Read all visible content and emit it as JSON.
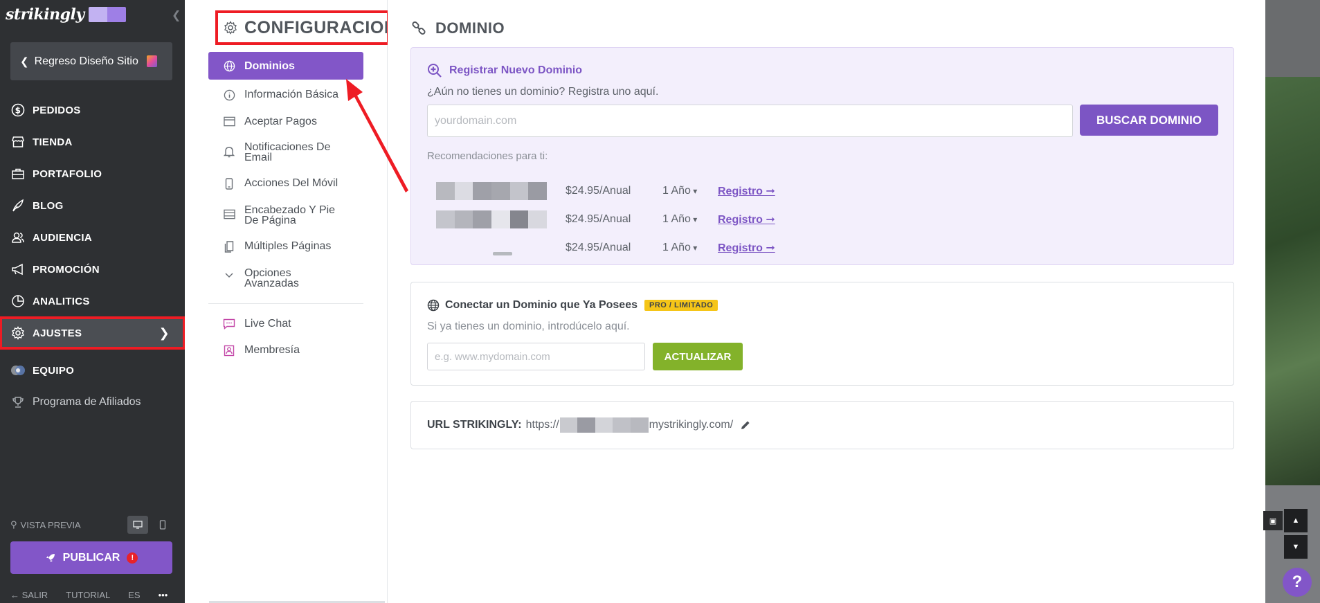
{
  "sidebar": {
    "logo_text": "strikingly",
    "back_label": "Regreso Diseño Sitio",
    "items": [
      {
        "label": "PEDIDOS",
        "icon": "dollar-icon"
      },
      {
        "label": "TIENDA",
        "icon": "store-icon"
      },
      {
        "label": "PORTAFOLIO",
        "icon": "briefcase-icon"
      },
      {
        "label": "BLOG",
        "icon": "feather-icon"
      },
      {
        "label": "AUDIENCIA",
        "icon": "users-icon"
      },
      {
        "label": "PROMOCIÓN",
        "icon": "megaphone-icon"
      },
      {
        "label": "ANALITICS",
        "icon": "pie-chart-icon"
      },
      {
        "label": "AJUSTES",
        "icon": "gear-icon",
        "active": true
      },
      {
        "label": "EQUIPO",
        "icon": "team-icon"
      },
      {
        "label": "Programa de Afiliados",
        "icon": "trophy-icon"
      }
    ],
    "preview_label": "VISTA PREVIA",
    "publish_label": "PUBLICAR",
    "publish_alert": "!",
    "exit_label": "SALIR",
    "tutorial_label": "TUTORIAL",
    "lang_label": "ES",
    "more_label": "•••"
  },
  "settings": {
    "title": "CONFIGURACION",
    "items": [
      {
        "label": "Dominios",
        "icon": "globe-icon",
        "active": true
      },
      {
        "label": "Información Básica",
        "icon": "info-icon"
      },
      {
        "label": "Aceptar Pagos",
        "icon": "card-icon"
      },
      {
        "label": "Notificaciones De Email",
        "icon": "bell-icon"
      },
      {
        "label": "Acciones Del Móvil",
        "icon": "mobile-icon"
      },
      {
        "label": "Encabezado Y Pie De Página",
        "icon": "layout-icon"
      },
      {
        "label": "Múltiples Páginas",
        "icon": "pages-icon"
      },
      {
        "label": "Opciones Avanzadas",
        "icon": "chevron-down-icon"
      }
    ],
    "extra_items": [
      {
        "label": "Live Chat",
        "icon": "chat-icon"
      },
      {
        "label": "Membresía",
        "icon": "member-icon"
      }
    ]
  },
  "domain": {
    "title": "DOMINIO",
    "register": {
      "heading": "Registrar Nuevo Dominio",
      "subtext": "¿Aún no tienes un dominio? Registra uno aquí.",
      "placeholder": "yourdomain.com",
      "button": "BUSCAR DOMINIO",
      "recommend_label": "Recomendaciones para ti:",
      "rows": [
        {
          "price": "$24.95/Anual",
          "term": "1 Año",
          "link": "Registro ➞"
        },
        {
          "price": "$24.95/Anual",
          "term": "1 Año",
          "link": "Registro ➞"
        },
        {
          "price": "$24.95/Anual",
          "term": "1 Año",
          "link": "Registro ➞"
        }
      ]
    },
    "connect": {
      "heading": "Conectar un Dominio que Ya Posees",
      "badge": "PRO / LIMITADO",
      "subtext": "Si ya tienes un dominio, introdúcelo aquí.",
      "placeholder": "e.g. www.mydomain.com",
      "button": "ACTUALIZAR"
    },
    "url": {
      "label": "URL STRIKINGLY:",
      "prefix": "https://",
      "suffix": "mystrikingly.com/"
    }
  },
  "help_label": "?",
  "colors": {
    "accent": "#8256c8",
    "sidebar_bg": "#2e3033",
    "annotation_red": "#ee1c24",
    "update_green": "#83b22a",
    "badge_yellow": "#f5c518"
  }
}
